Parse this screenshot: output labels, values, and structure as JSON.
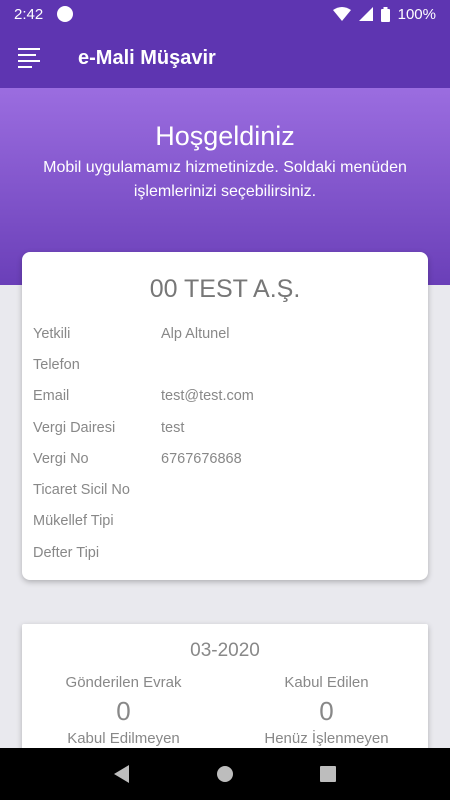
{
  "status_bar": {
    "time": "2:42",
    "battery": "100%"
  },
  "app_bar": {
    "title": "e-Mali Müşavir"
  },
  "hero": {
    "title": "Hoşgeldiniz",
    "subtitle": "Mobil uygulamamız hizmetinizde. Soldaki menüden işlemlerinizi seçebilirsiniz."
  },
  "company": {
    "name": "00 TEST A.Ş.",
    "rows": [
      {
        "label": "Yetkili",
        "value": "Alp Altunel"
      },
      {
        "label": "Telefon",
        "value": ""
      },
      {
        "label": "Email",
        "value": "test@test.com"
      },
      {
        "label": "Vergi Dairesi",
        "value": "test"
      },
      {
        "label": "Vergi No",
        "value": "6767676868"
      },
      {
        "label": "Ticaret Sicil No",
        "value": ""
      },
      {
        "label": "Mükellef Tipi",
        "value": ""
      },
      {
        "label": "Defter Tipi",
        "value": ""
      }
    ]
  },
  "stats": {
    "period": "03-2020",
    "items": [
      {
        "label": "Gönderilen Evrak",
        "value": "0"
      },
      {
        "label": "Kabul Edilen",
        "value": "0"
      },
      {
        "label": "Kabul Edilmeyen",
        "value": ""
      },
      {
        "label": "Henüz İşlenmeyen",
        "value": ""
      }
    ]
  },
  "colors": {
    "primary": "#5e35b1",
    "hero_top": "#9b6de0",
    "hero_bottom": "#6a3fb8"
  }
}
